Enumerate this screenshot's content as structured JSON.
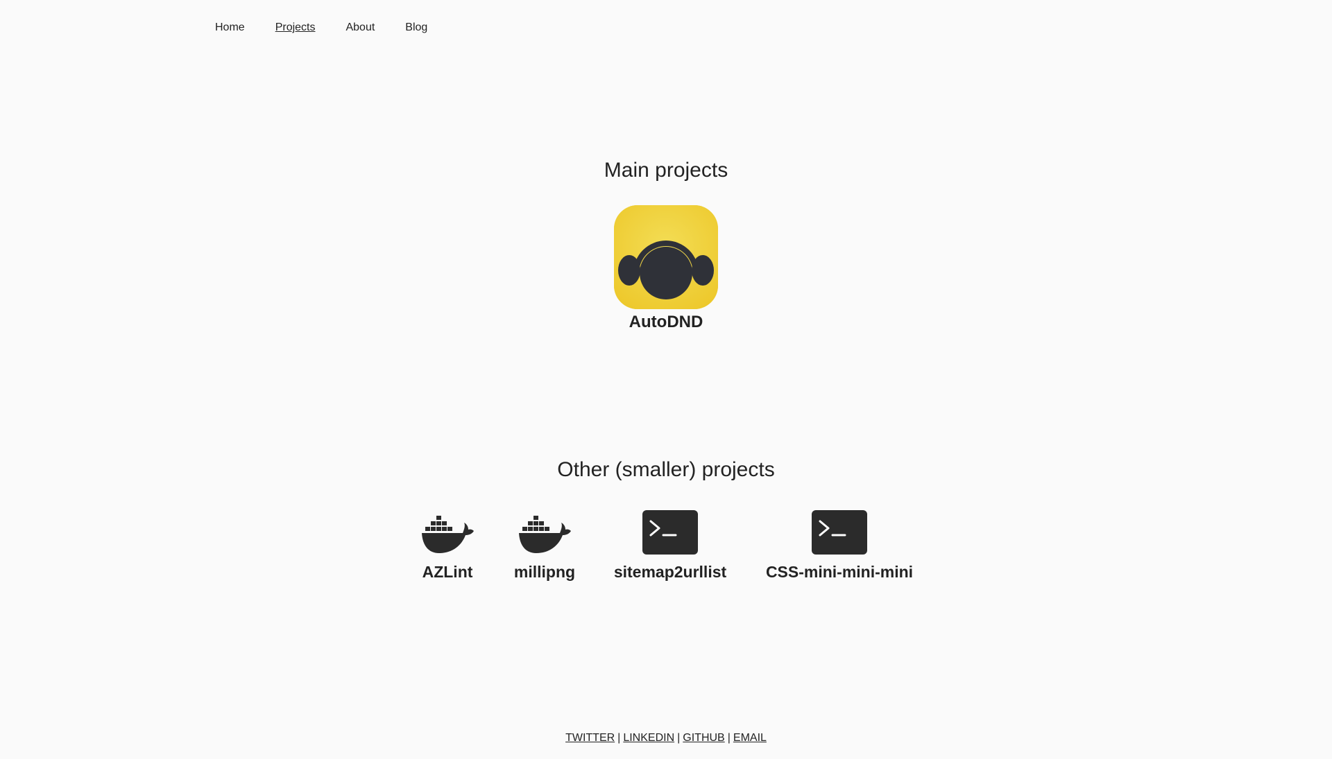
{
  "nav": {
    "items": [
      {
        "label": "Home",
        "current": false
      },
      {
        "label": "Projects",
        "current": true
      },
      {
        "label": "About",
        "current": false
      },
      {
        "label": "Blog",
        "current": false
      }
    ]
  },
  "main_section": {
    "title": "Main projects",
    "project": {
      "label": "AutoDND",
      "icon": "headphones-app-icon"
    }
  },
  "other_section": {
    "title": "Other (smaller) projects",
    "projects": [
      {
        "label": "AZLint",
        "icon": "docker-whale-icon"
      },
      {
        "label": "millipng",
        "icon": "docker-whale-icon"
      },
      {
        "label": "sitemap2urllist",
        "icon": "terminal-icon"
      },
      {
        "label": "CSS-mini-mini-mini",
        "icon": "terminal-icon"
      }
    ]
  },
  "footer": {
    "links": [
      "TWITTER",
      "LINKEDIN",
      "GITHUB",
      "EMAIL"
    ],
    "separator": "|"
  },
  "colors": {
    "background": "#fafafa",
    "text": "#222222",
    "app_icon_yellow": "#f0d43e",
    "icon_dark": "#2b2b2b"
  }
}
